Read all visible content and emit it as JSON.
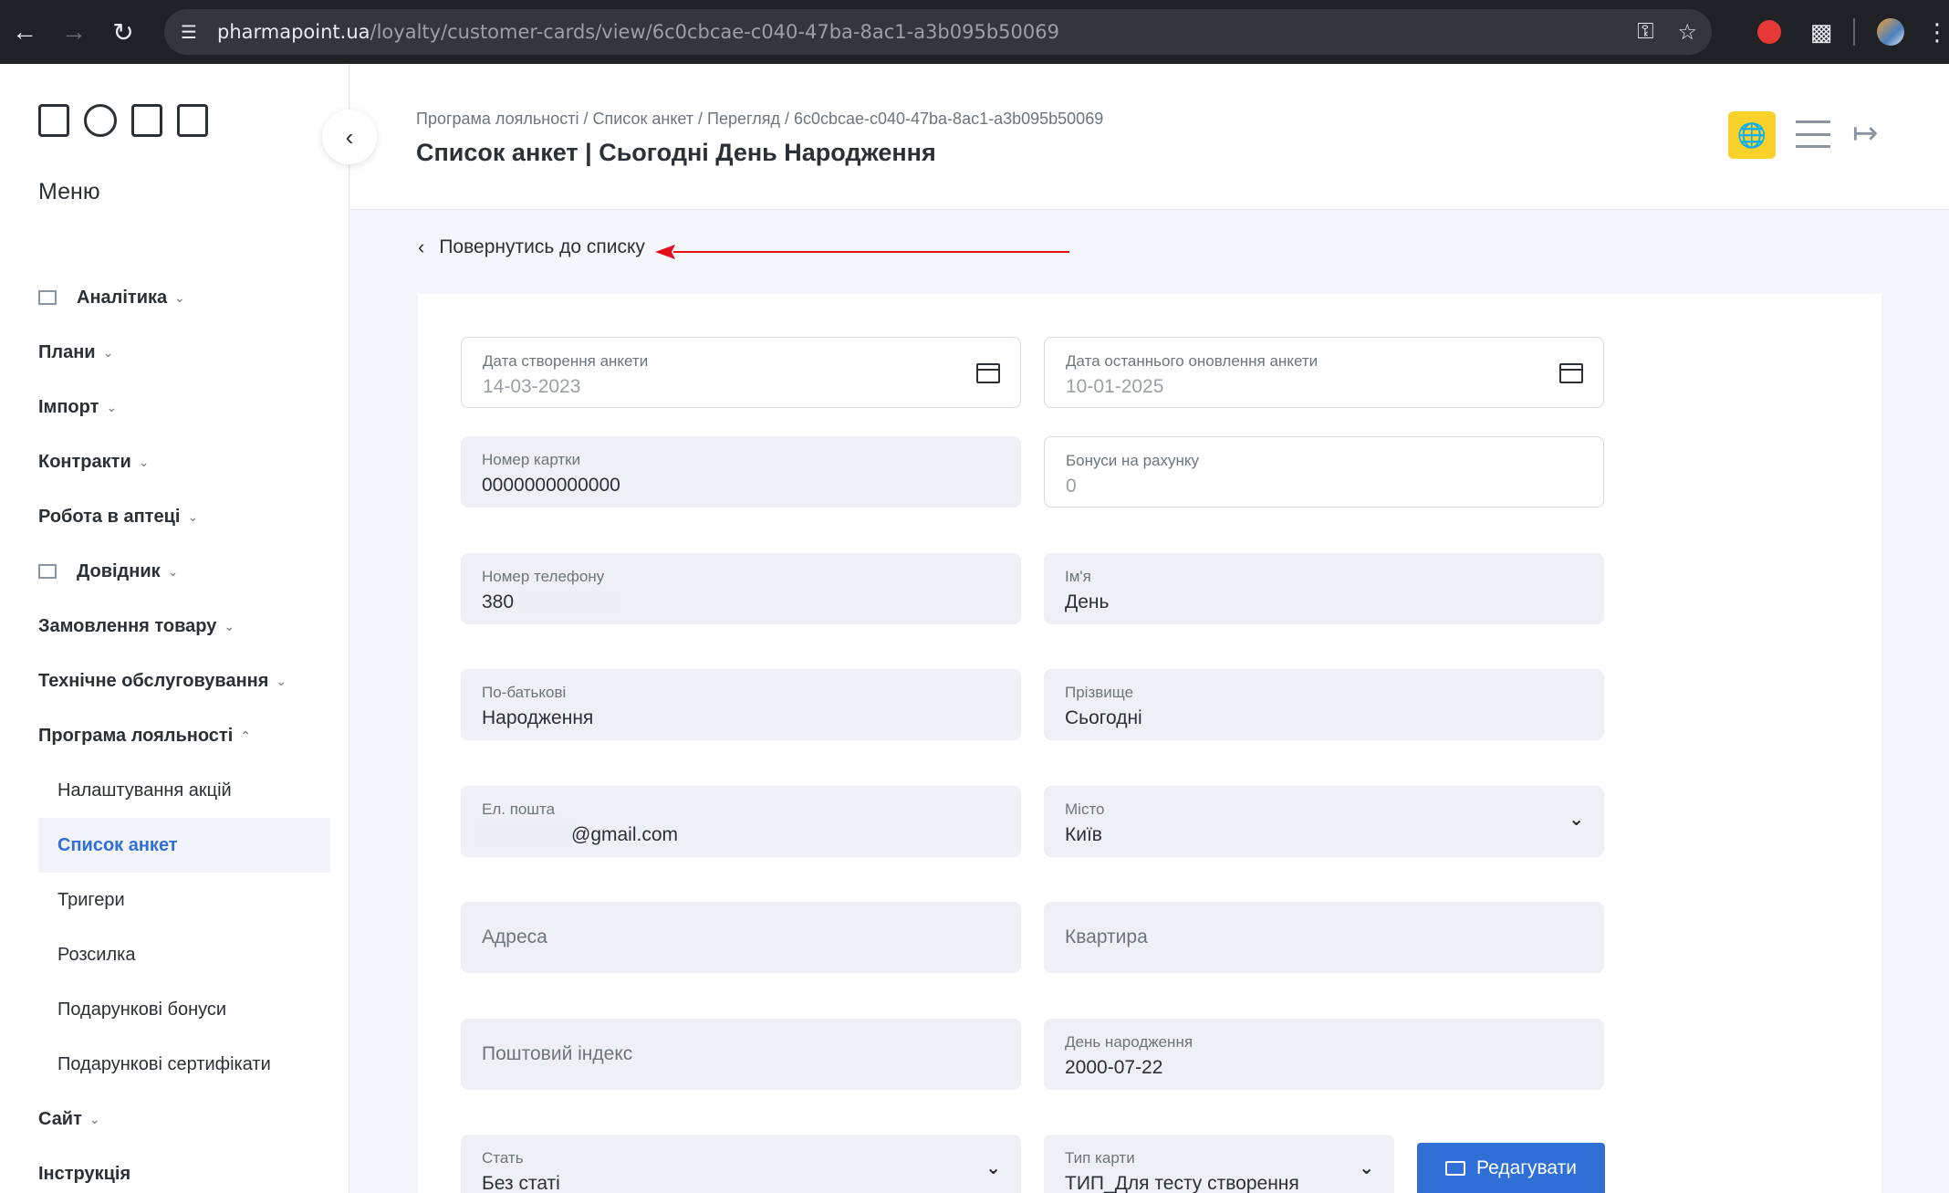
{
  "browser": {
    "url_host": "pharmapoint.ua",
    "url_path": "/loyalty/customer-cards/view/6c0cbcae-c040-47ba-8ac1-a3b095b50069"
  },
  "sidebar": {
    "menu_title": "Меню",
    "items": [
      {
        "label": "Аналітика",
        "icon": "grid-icon"
      },
      {
        "label": "Плани"
      },
      {
        "label": "Імпорт"
      },
      {
        "label": "Контракти"
      },
      {
        "label": "Робота в аптеці"
      },
      {
        "label": "Довідник",
        "icon": "list-icon"
      },
      {
        "label": "Замовлення товару"
      },
      {
        "label": "Технічне обслуговування"
      },
      {
        "label": "Програма лояльності"
      },
      {
        "label": "Налаштування акцій"
      },
      {
        "label": "Список анкет"
      },
      {
        "label": "Тригери"
      },
      {
        "label": "Розсилка"
      },
      {
        "label": "Подарункові бонуси"
      },
      {
        "label": "Подарункові сертифікати"
      },
      {
        "label": "Сайт"
      },
      {
        "label": "Інструкція"
      }
    ]
  },
  "header": {
    "breadcrumb": "Програма лояльності / Список анкет / Перегляд / 6c0cbcae-c040-47ba-8ac1-a3b095b50069",
    "title": "Список анкет | Сьогодні День Народження"
  },
  "back_link": "Повернутись до списку",
  "form": {
    "created_label": "Дата створення анкети",
    "created_value": "14-03-2023",
    "updated_label": "Дата останнього оновлення анкети",
    "updated_value": "10-01-2025",
    "card_label": "Номер картки",
    "card_value": "0000000000000",
    "bonus_label": "Бонуси на рахунку",
    "bonus_value": "0",
    "phone_label": "Номер телефону",
    "phone_value": "380",
    "name_label": "Ім'я",
    "name_value": "День",
    "patronymic_label": "По-батькові",
    "patronymic_value": "Народження",
    "surname_label": "Прізвище",
    "surname_value": "Сьогодні",
    "email_label": "Ел. пошта",
    "email_value": "@gmail.com",
    "city_label": "Місто",
    "city_value": "Київ",
    "address_placeholder": "Адреса",
    "apartment_placeholder": "Квартира",
    "postcode_placeholder": "Поштовий індекс",
    "birthday_label": "День народження",
    "birthday_value": "2000-07-22",
    "gender_label": "Стать",
    "gender_value": "Без статі",
    "card_type_label": "Тип карти",
    "card_type_value": "ТИП_Для тесту створення",
    "edit_button": "Редагувати"
  },
  "colors": {
    "accent": "#2f6fd6",
    "lang_button": "#f8d22a",
    "annotation_arrow": "#e3101a"
  }
}
